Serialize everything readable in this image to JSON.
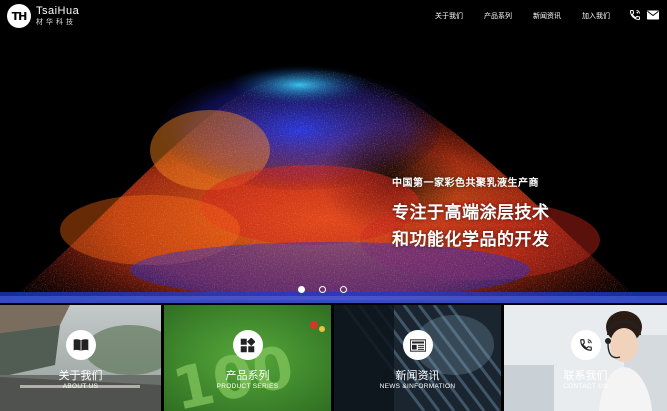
{
  "brand": {
    "name_en": "TsaiHua",
    "name_cn": "材华科技",
    "mark": "TH"
  },
  "nav": {
    "items": [
      "关于我们",
      "产品系列",
      "新闻资讯",
      "加入我们"
    ],
    "icons": [
      "phone-icon",
      "mail-icon"
    ]
  },
  "hero": {
    "line1": "中国第一家彩色共聚乳液生产商",
    "line2": "专注于高端涂层技术",
    "line3": "和功能化学品的开发",
    "slides_total": 3,
    "slide_active": 1
  },
  "tiles": [
    {
      "cn": "关于我们",
      "en": "ABOUT US",
      "icon": "book-icon"
    },
    {
      "cn": "产品系列",
      "en": "PRODUCT SERIES",
      "icon": "grid-icon"
    },
    {
      "cn": "新闻资讯",
      "en": "NEWS &INFORMATION",
      "icon": "newspaper-icon"
    },
    {
      "cn": "联系我们",
      "en": "CONTACT US",
      "icon": "phone-icon"
    }
  ],
  "colors": {
    "accent": "#ffffff",
    "background": "#000000",
    "tile_green": "#3f8f2e"
  }
}
